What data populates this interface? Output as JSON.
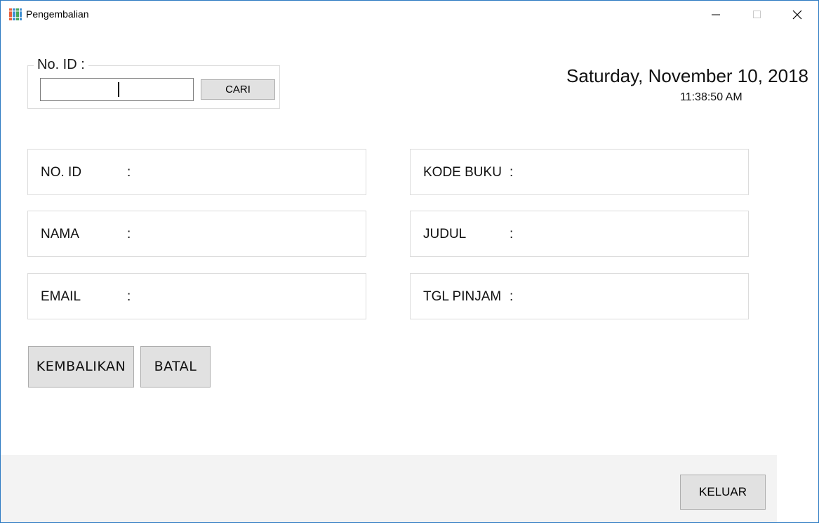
{
  "window": {
    "title": "Pengembalian",
    "icon": "books-icon",
    "border_color": "#2b79c2"
  },
  "search": {
    "legend": "No. ID :",
    "value": "",
    "button_label": "CARI"
  },
  "clock": {
    "date": "Saturday, November 10, 2018",
    "time": "11:38:50 AM"
  },
  "member_fields": [
    {
      "label": "NO. ID",
      "colon": ":"
    },
    {
      "label": "NAMA",
      "colon": ":"
    },
    {
      "label": "EMAIL",
      "colon": ":"
    }
  ],
  "book_fields": [
    {
      "label": "KODE BUKU",
      "colon": ":"
    },
    {
      "label": "JUDUL",
      "colon": ":"
    },
    {
      "label": "TGL PINJAM",
      "colon": ":"
    }
  ],
  "actions": {
    "return_label": "KEMBALIKAN",
    "cancel_label": "BATAL",
    "exit_label": "KELUAR"
  },
  "colors": {
    "button_bg": "#e1e1e1",
    "footer_bg": "#f3f3f3"
  }
}
